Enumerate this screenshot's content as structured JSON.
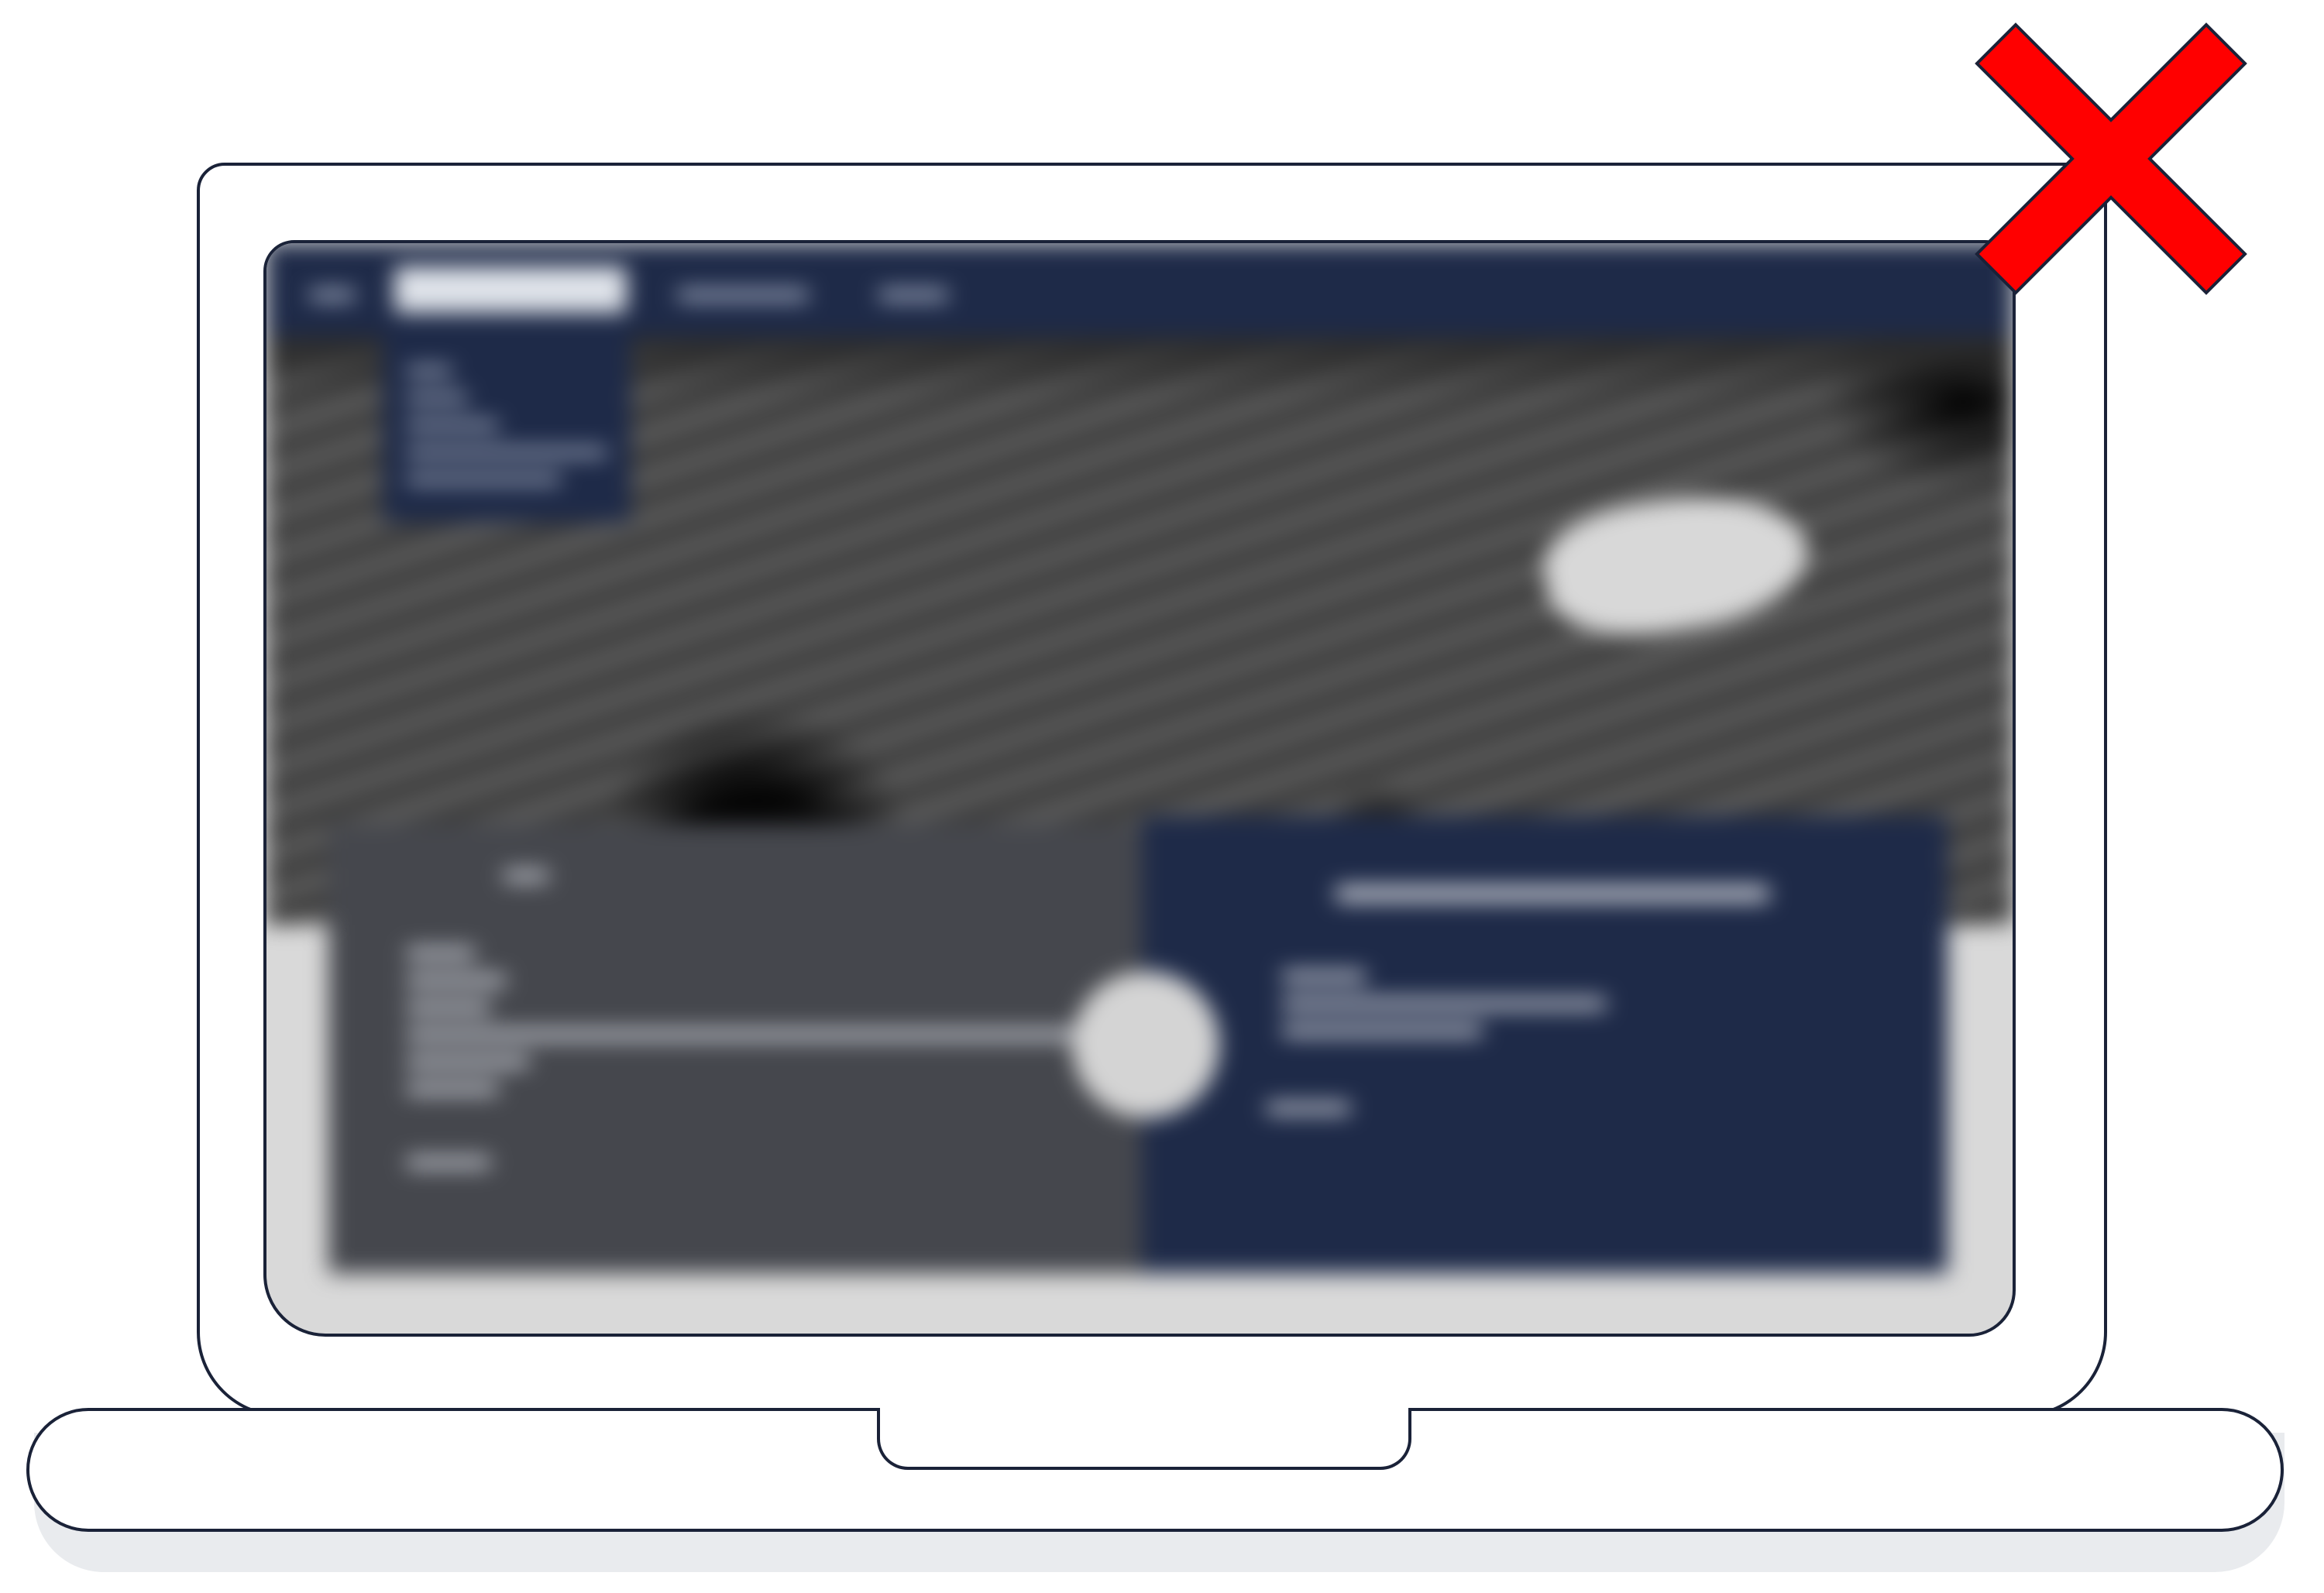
{
  "illustration": {
    "device": "laptop",
    "screen_content": "blurred-website",
    "status_icon": "close-x-icon"
  },
  "colors": {
    "outline": "#1a2238",
    "nav_background": "#1e2a48",
    "panel_gray": "#45474d",
    "panel_blue": "#1e2a48",
    "close_mark": "#ff0000",
    "base_shadow": "#e9ebee"
  }
}
